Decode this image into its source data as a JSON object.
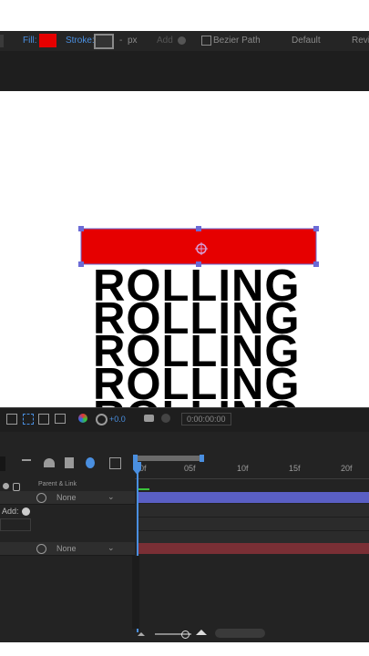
{
  "toolbar": {
    "fill_label": "Fill:",
    "fill_color": "#e60000",
    "stroke_label": "Stroke:",
    "stroke_value": "-",
    "stroke_unit": "px",
    "add_label": "Add",
    "bezier_label": "Bezier Path",
    "workspace_default": "Default",
    "workspace_review": "Revi"
  },
  "canvas": {
    "text_lines": [
      "ROLLING",
      "ROLLING",
      "ROLLING",
      "ROLLING",
      "ROLLING"
    ],
    "shape_color": "#e60000"
  },
  "timeline": {
    "exposure": "+0.0",
    "timecode": "0:00:00:00",
    "parent_link_header": "Parent & Link",
    "add_label": "Add:",
    "layers": [
      {
        "parent": "None"
      },
      {
        "parent": "None"
      }
    ],
    "ruler": [
      "0f",
      "05f",
      "10f",
      "15f",
      "20f"
    ],
    "bar_blue": "#5a5fc4",
    "bar_red": "#7a2f35"
  }
}
